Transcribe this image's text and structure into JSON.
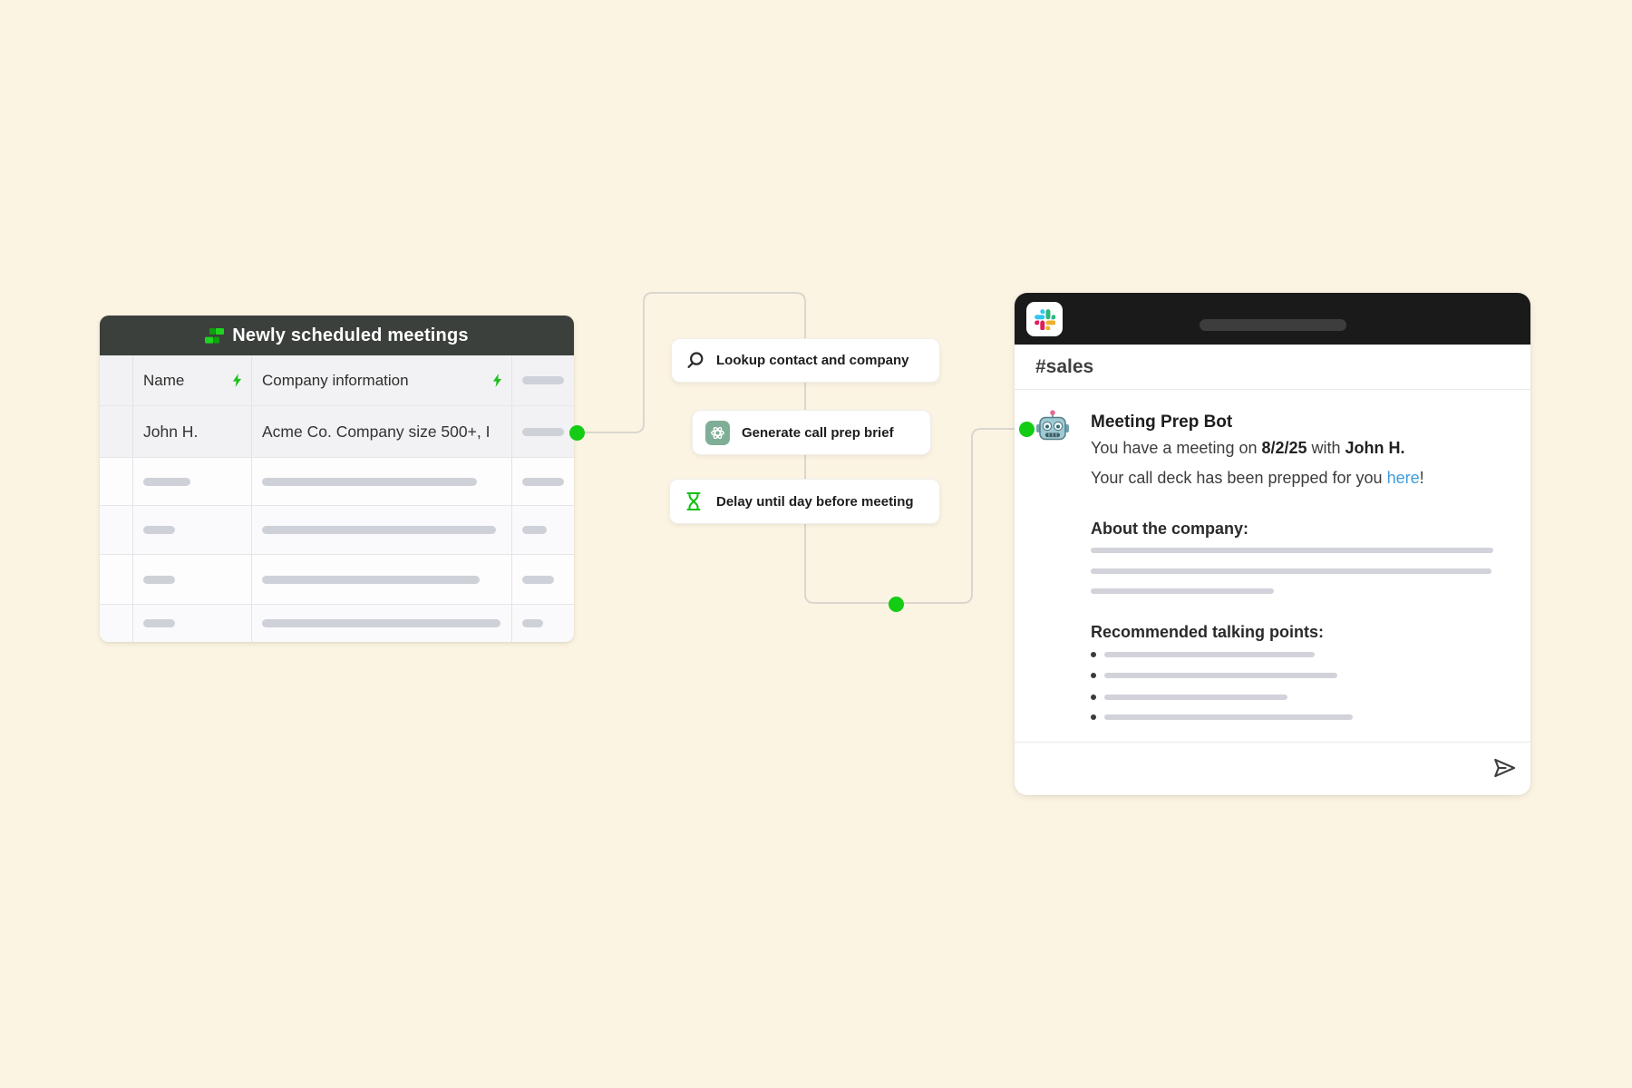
{
  "colors": {
    "background": "#fcf4e3",
    "accent_green": "#13cc13",
    "table_header_bg": "#3b403c",
    "slack_topbar_bg": "#1a1a1a",
    "openai_badge_bg": "#7fae97",
    "link_blue": "#3e9bdc",
    "placeholder_gray": "#cfd1d9"
  },
  "table": {
    "title": "Newly scheduled meetings",
    "title_icon": "tables-icon",
    "columns": {
      "name": "Name",
      "company": "Company information",
      "header_icon": "zap-icon"
    },
    "row1": {
      "name": "John H.",
      "company": "Acme Co. Company size 500+, I"
    }
  },
  "workflow": {
    "steps": [
      {
        "icon": "search-icon",
        "label": "Lookup contact and company"
      },
      {
        "icon": "openai-icon",
        "label": "Generate call prep brief"
      },
      {
        "icon": "hourglass-icon",
        "label": "Delay until day before meeting"
      }
    ]
  },
  "slack": {
    "channel": "#sales",
    "bot_name": "Meeting Prep Bot",
    "avatar_icon": "robot-avatar-icon",
    "line1": {
      "prefix": "You have a meeting on ",
      "date": "8/2/25",
      "mid": " with ",
      "name": "John H."
    },
    "line2": {
      "prefix": "Your call deck has been prepped for you ",
      "link": "here",
      "suffix": "!"
    },
    "about_heading": "About the company:",
    "points_heading": "Recommended talking points:",
    "send_icon": "send-icon"
  }
}
